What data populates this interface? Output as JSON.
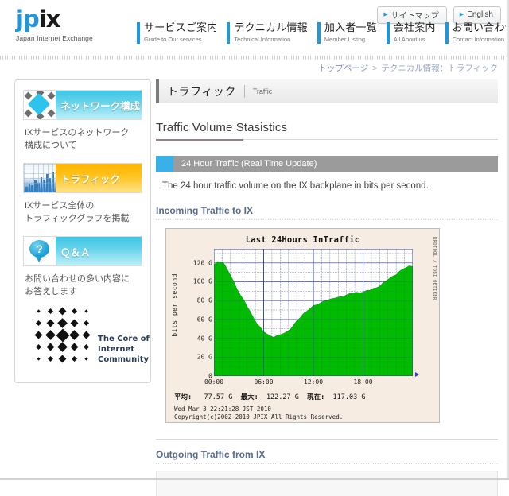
{
  "header": {
    "logo_main_blue": "jp",
    "logo_main_dark": "ix",
    "logo_sub": "Japan Internet Exchange",
    "top_buttons": [
      {
        "label": "サイトマップ",
        "icon": "triangle-right-icon"
      },
      {
        "label": "English",
        "icon": "triangle-right-icon"
      }
    ],
    "nav": [
      {
        "ja": "サービスご案内",
        "en": "Guide to Our services"
      },
      {
        "ja": "テクニカル情報",
        "en": "Technical Information"
      },
      {
        "ja": "加入者一覧",
        "en": "Member Listing"
      },
      {
        "ja": "会社案内",
        "en": "All About us"
      },
      {
        "ja": "お問い合わせ",
        "en": "Contact Information"
      }
    ]
  },
  "breadcrumb": {
    "home": "トップページ",
    "separator": ">",
    "current": "テクニカル情報：トラフィック"
  },
  "sidebar": {
    "items": [
      {
        "label": "ネットワーク構成",
        "icon": "network-diamond-icon",
        "desc_line1": "IXサービスのネットワーク",
        "desc_line2": "構成について"
      },
      {
        "label": "トラフィック",
        "icon": "traffic-chart-icon",
        "desc_line1": "IXサービス全体の",
        "desc_line2": "トラフィックグラフを掲載"
      },
      {
        "label": "Ｑ＆Ａ",
        "icon": "question-bubble-icon",
        "desc_line1": "お問い合わせの多い内容に",
        "desc_line2": "お答えします"
      }
    ],
    "core_logo": {
      "line1": "The Core of",
      "line2": "Internet Community"
    }
  },
  "main": {
    "page_title_ja": "トラフィック",
    "page_title_en": "Traffic",
    "section_title": "Traffic Volume Stasistics",
    "subsection_title": "24 Hour Traffic (Real Time Update)",
    "blurb": "The 24 hour traffic volume on the IX backplane in bits per second.",
    "incoming_title": "Incoming Traffic to IX",
    "outgoing_title": "Outgoing Traffic from IX"
  },
  "graph": {
    "title": "Last 24Hours InTraffic",
    "right_label": "RRDTOOL / TOBI OETIKER",
    "stats": {
      "avg_label": "平均:",
      "avg_value": "77.57 G",
      "max_label": "最大:",
      "max_value": "122.27 G",
      "cur_label": "現在:",
      "cur_value": "117.03 G"
    },
    "timestamp": "Wed Mar  3 22:21:28 JST 2010",
    "copyright": "Copyright(c)2002-2010 JPIX All Rights Reserved.",
    "accent_color": "#00bb00",
    "background_color": "#f7ece2"
  },
  "chart_data": {
    "type": "area",
    "title": "Last 24Hours InTraffic",
    "xlabel": "",
    "ylabel": "bits per second",
    "ylim": [
      0,
      135
    ],
    "xlim": [
      0,
      24
    ],
    "grid": true,
    "legend": false,
    "ytick_labels": [
      "0",
      "20 G",
      "40 G",
      "60 G",
      "80 G",
      "100 G",
      "120 G"
    ],
    "ytick_values": [
      0,
      20,
      40,
      60,
      80,
      100,
      120
    ],
    "xtick_labels": [
      "00:00",
      "06:00",
      "12:00",
      "18:00"
    ],
    "xtick_values": [
      0,
      6,
      12,
      18
    ],
    "series": [
      {
        "name": "InTraffic",
        "color": "#00bb00",
        "x": [
          0.0,
          0.4,
          0.8,
          1.2,
          1.6,
          2.0,
          2.4,
          2.8,
          3.2,
          3.6,
          4.0,
          4.4,
          4.8,
          5.2,
          5.6,
          6.0,
          6.4,
          6.8,
          7.2,
          7.6,
          8.0,
          8.4,
          8.8,
          9.2,
          9.6,
          10.0,
          10.4,
          10.8,
          11.2,
          11.6,
          12.0,
          12.4,
          12.8,
          13.2,
          13.6,
          14.0,
          14.4,
          14.8,
          15.2,
          15.6,
          16.0,
          16.4,
          16.8,
          17.2,
          17.6,
          18.0,
          18.4,
          18.8,
          19.2,
          19.6,
          20.0,
          20.4,
          20.8,
          21.2,
          21.6,
          22.0,
          22.4,
          22.8,
          23.2,
          23.6,
          24.0
        ],
        "y": [
          118.0,
          121.5,
          122.3,
          119.0,
          113.0,
          107.0,
          100.0,
          93.0,
          86.0,
          80.0,
          74.0,
          68.0,
          62.0,
          56.0,
          51.0,
          47.0,
          44.5,
          43.0,
          42.0,
          42.3,
          43.5,
          45.0,
          47.0,
          50.0,
          54.0,
          58.0,
          62.0,
          66.0,
          69.5,
          72.0,
          74.0,
          75.5,
          77.0,
          79.5,
          80.5,
          81.0,
          82.0,
          83.0,
          84.0,
          85.0,
          86.0,
          87.0,
          88.0,
          88.5,
          89.0,
          89.5,
          90.0,
          91.0,
          92.5,
          94.0,
          96.0,
          98.5,
          101.0,
          103.5,
          106.0,
          108.5,
          111.0,
          113.0,
          115.0,
          116.5,
          117.0
        ]
      }
    ],
    "annotations": {
      "average": 77.57,
      "maximum": 122.27,
      "current": 117.03
    }
  }
}
